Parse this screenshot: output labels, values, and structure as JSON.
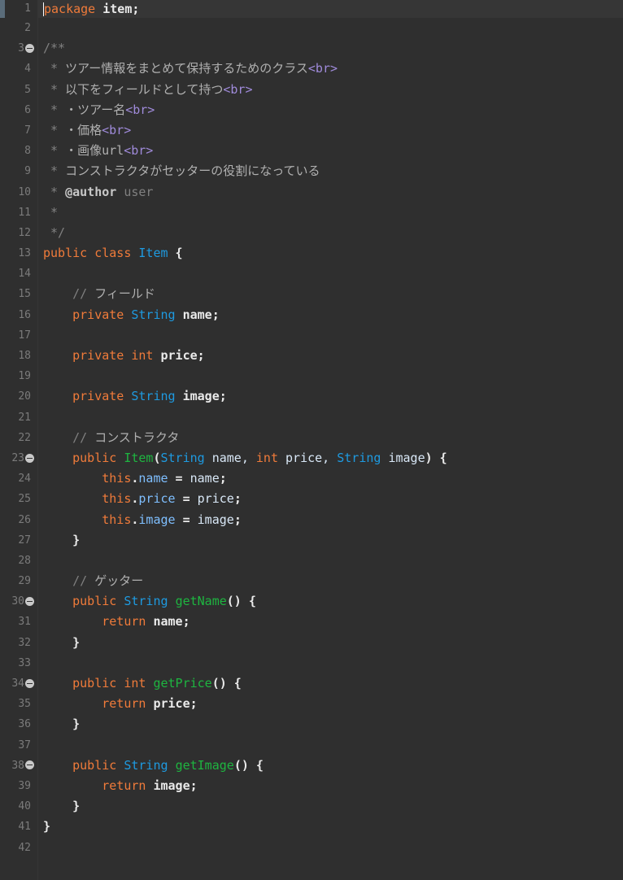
{
  "editor": {
    "lines": [
      {
        "n": "1",
        "fold": false,
        "segs": [
          {
            "c": "kw",
            "t": "package"
          },
          {
            "c": "wht",
            "t": " item;"
          }
        ]
      },
      {
        "n": "2",
        "fold": false,
        "segs": []
      },
      {
        "n": "3",
        "fold": true,
        "segs": [
          {
            "c": "cm",
            "t": "/**"
          }
        ]
      },
      {
        "n": "4",
        "fold": false,
        "segs": [
          {
            "c": "cm",
            "t": " * "
          },
          {
            "c": "jp",
            "t": "ツアー情報をまとめて保持するためのクラス"
          },
          {
            "c": "tag",
            "t": "<br>"
          }
        ]
      },
      {
        "n": "5",
        "fold": false,
        "segs": [
          {
            "c": "cm",
            "t": " * "
          },
          {
            "c": "jp",
            "t": "以下をフィールドとして持つ"
          },
          {
            "c": "tag",
            "t": "<br>"
          }
        ]
      },
      {
        "n": "6",
        "fold": false,
        "segs": [
          {
            "c": "cm",
            "t": " * "
          },
          {
            "c": "jp",
            "t": "・ツアー名"
          },
          {
            "c": "tag",
            "t": "<br>"
          }
        ]
      },
      {
        "n": "7",
        "fold": false,
        "segs": [
          {
            "c": "cm",
            "t": " * "
          },
          {
            "c": "jp",
            "t": "・価格"
          },
          {
            "c": "tag",
            "t": "<br>"
          }
        ]
      },
      {
        "n": "8",
        "fold": false,
        "segs": [
          {
            "c": "cm",
            "t": " * "
          },
          {
            "c": "jp",
            "t": "・画像url"
          },
          {
            "c": "tag",
            "t": "<br>"
          }
        ]
      },
      {
        "n": "9",
        "fold": false,
        "segs": [
          {
            "c": "cm",
            "t": " * "
          },
          {
            "c": "jp",
            "t": "コンストラクタがセッターの役割になっている"
          }
        ]
      },
      {
        "n": "10",
        "fold": false,
        "segs": [
          {
            "c": "cm",
            "t": " * "
          },
          {
            "c": "at",
            "t": "@author"
          },
          {
            "c": "cm",
            "t": " user"
          }
        ]
      },
      {
        "n": "11",
        "fold": false,
        "segs": [
          {
            "c": "cm",
            "t": " *"
          }
        ]
      },
      {
        "n": "12",
        "fold": false,
        "segs": [
          {
            "c": "cm",
            "t": " */"
          }
        ]
      },
      {
        "n": "13",
        "fold": false,
        "segs": [
          {
            "c": "kw",
            "t": "public"
          },
          {
            "c": "plain",
            "t": " "
          },
          {
            "c": "kw",
            "t": "class"
          },
          {
            "c": "plain",
            "t": " "
          },
          {
            "c": "ty",
            "t": "Item"
          },
          {
            "c": "wht",
            "t": " {"
          }
        ]
      },
      {
        "n": "14",
        "fold": false,
        "segs": []
      },
      {
        "n": "15",
        "fold": false,
        "segs": [
          {
            "c": "cm",
            "t": "    // "
          },
          {
            "c": "jp",
            "t": "フィールド"
          }
        ]
      },
      {
        "n": "16",
        "fold": false,
        "segs": [
          {
            "c": "kw",
            "t": "    private"
          },
          {
            "c": "plain",
            "t": " "
          },
          {
            "c": "ty",
            "t": "String"
          },
          {
            "c": "wht",
            "t": " name;"
          }
        ]
      },
      {
        "n": "17",
        "fold": false,
        "segs": []
      },
      {
        "n": "18",
        "fold": false,
        "segs": [
          {
            "c": "kw",
            "t": "    private"
          },
          {
            "c": "plain",
            "t": " "
          },
          {
            "c": "kw",
            "t": "int"
          },
          {
            "c": "wht",
            "t": " price;"
          }
        ]
      },
      {
        "n": "19",
        "fold": false,
        "segs": []
      },
      {
        "n": "20",
        "fold": false,
        "segs": [
          {
            "c": "kw",
            "t": "    private"
          },
          {
            "c": "plain",
            "t": " "
          },
          {
            "c": "ty",
            "t": "String"
          },
          {
            "c": "wht",
            "t": " image;"
          }
        ]
      },
      {
        "n": "21",
        "fold": false,
        "segs": []
      },
      {
        "n": "22",
        "fold": false,
        "segs": [
          {
            "c": "cm",
            "t": "    // "
          },
          {
            "c": "jp",
            "t": "コンストラクタ"
          }
        ]
      },
      {
        "n": "23",
        "fold": true,
        "segs": [
          {
            "c": "kw",
            "t": "    public"
          },
          {
            "c": "plain",
            "t": " "
          },
          {
            "c": "mth",
            "t": "Item"
          },
          {
            "c": "wht",
            "t": "("
          },
          {
            "c": "ty",
            "t": "String"
          },
          {
            "c": "plain",
            "t": " name, "
          },
          {
            "c": "kw",
            "t": "int"
          },
          {
            "c": "plain",
            "t": " price, "
          },
          {
            "c": "ty",
            "t": "String"
          },
          {
            "c": "plain",
            "t": " image"
          },
          {
            "c": "wht",
            "t": ") {"
          }
        ]
      },
      {
        "n": "24",
        "fold": false,
        "segs": [
          {
            "c": "kw",
            "t": "        this"
          },
          {
            "c": "wht",
            "t": "."
          },
          {
            "c": "fld",
            "t": "name"
          },
          {
            "c": "wht",
            "t": " = "
          },
          {
            "c": "plain",
            "t": "name"
          },
          {
            "c": "wht",
            "t": ";"
          }
        ]
      },
      {
        "n": "25",
        "fold": false,
        "segs": [
          {
            "c": "kw",
            "t": "        this"
          },
          {
            "c": "wht",
            "t": "."
          },
          {
            "c": "fld",
            "t": "price"
          },
          {
            "c": "wht",
            "t": " = "
          },
          {
            "c": "plain",
            "t": "price"
          },
          {
            "c": "wht",
            "t": ";"
          }
        ]
      },
      {
        "n": "26",
        "fold": false,
        "segs": [
          {
            "c": "kw",
            "t": "        this"
          },
          {
            "c": "wht",
            "t": "."
          },
          {
            "c": "fld",
            "t": "image"
          },
          {
            "c": "wht",
            "t": " = "
          },
          {
            "c": "plain",
            "t": "image"
          },
          {
            "c": "wht",
            "t": ";"
          }
        ]
      },
      {
        "n": "27",
        "fold": false,
        "segs": [
          {
            "c": "wht",
            "t": "    }"
          }
        ]
      },
      {
        "n": "28",
        "fold": false,
        "segs": []
      },
      {
        "n": "29",
        "fold": false,
        "segs": [
          {
            "c": "cm",
            "t": "    // "
          },
          {
            "c": "jp",
            "t": "ゲッター"
          }
        ]
      },
      {
        "n": "30",
        "fold": true,
        "segs": [
          {
            "c": "kw",
            "t": "    public"
          },
          {
            "c": "plain",
            "t": " "
          },
          {
            "c": "ty",
            "t": "String"
          },
          {
            "c": "plain",
            "t": " "
          },
          {
            "c": "mth",
            "t": "getName"
          },
          {
            "c": "wht",
            "t": "() {"
          }
        ]
      },
      {
        "n": "31",
        "fold": false,
        "segs": [
          {
            "c": "kw",
            "t": "        return"
          },
          {
            "c": "wht",
            "t": " name;"
          }
        ]
      },
      {
        "n": "32",
        "fold": false,
        "segs": [
          {
            "c": "wht",
            "t": "    }"
          }
        ]
      },
      {
        "n": "33",
        "fold": false,
        "segs": []
      },
      {
        "n": "34",
        "fold": true,
        "segs": [
          {
            "c": "kw",
            "t": "    public"
          },
          {
            "c": "plain",
            "t": " "
          },
          {
            "c": "kw",
            "t": "int"
          },
          {
            "c": "plain",
            "t": " "
          },
          {
            "c": "mth",
            "t": "getPrice"
          },
          {
            "c": "wht",
            "t": "() {"
          }
        ]
      },
      {
        "n": "35",
        "fold": false,
        "segs": [
          {
            "c": "kw",
            "t": "        return"
          },
          {
            "c": "wht",
            "t": " price;"
          }
        ]
      },
      {
        "n": "36",
        "fold": false,
        "segs": [
          {
            "c": "wht",
            "t": "    }"
          }
        ]
      },
      {
        "n": "37",
        "fold": false,
        "segs": []
      },
      {
        "n": "38",
        "fold": true,
        "segs": [
          {
            "c": "kw",
            "t": "    public"
          },
          {
            "c": "plain",
            "t": " "
          },
          {
            "c": "ty",
            "t": "String"
          },
          {
            "c": "plain",
            "t": " "
          },
          {
            "c": "mth",
            "t": "getImage"
          },
          {
            "c": "wht",
            "t": "() {"
          }
        ]
      },
      {
        "n": "39",
        "fold": false,
        "segs": [
          {
            "c": "kw",
            "t": "        return"
          },
          {
            "c": "wht",
            "t": " image;"
          }
        ]
      },
      {
        "n": "40",
        "fold": false,
        "segs": [
          {
            "c": "wht",
            "t": "    }"
          }
        ]
      },
      {
        "n": "41",
        "fold": false,
        "segs": [
          {
            "c": "wht",
            "t": "}"
          }
        ]
      },
      {
        "n": "42",
        "fold": false,
        "segs": []
      }
    ],
    "colors": {
      "background": "#2f2f2f",
      "keyword": "#f07b3a",
      "type": "#1e9ae0",
      "method": "#1eb540",
      "comment": "#808080",
      "javadoc_tag": "#a08bdb",
      "identifier": "#d9e8f7"
    }
  }
}
